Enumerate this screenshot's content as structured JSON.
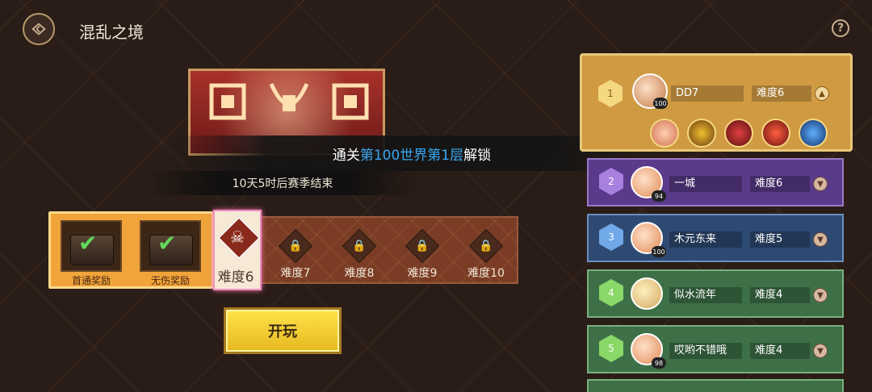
{
  "header": {
    "title": "混乱之境",
    "help_label": "?"
  },
  "unlock": {
    "prefix": "通关",
    "highlight": "第100世界第1层",
    "suffix": "解锁"
  },
  "season": {
    "text": "10天5时后赛季结束"
  },
  "rewards": [
    {
      "label": "首通奖励",
      "claimed": true
    },
    {
      "label": "无伤奖励",
      "claimed": true
    }
  ],
  "difficulty": {
    "current": "难度6",
    "locked": [
      "难度7",
      "难度8",
      "难度9",
      "难度10"
    ]
  },
  "play_button": {
    "label": "开玩"
  },
  "leaderboard": [
    {
      "rank": "1",
      "name": "DD7",
      "difficulty": "难度6",
      "level": "100",
      "expanded": true
    },
    {
      "rank": "2",
      "name": "一城",
      "difficulty": "难度6",
      "level": "94"
    },
    {
      "rank": "3",
      "name": "木元东来",
      "difficulty": "难度5",
      "level": "100"
    },
    {
      "rank": "4",
      "name": "似水流年",
      "difficulty": "难度4",
      "level": ""
    },
    {
      "rank": "5",
      "name": "哎哟不错哦",
      "difficulty": "难度4",
      "level": "98"
    }
  ],
  "colors": {
    "highlight": "#39a6f0",
    "rank_gold": "#cf9a42",
    "rank_purple": "#5a3a8a",
    "rank_blue": "#2e4a72",
    "rank_green": "#3e7048"
  },
  "icons": [
    "back-arrow-icon",
    "help-icon",
    "lock-icon",
    "check-icon",
    "chevron-up-icon",
    "chevron-down-icon",
    "skull-icon"
  ]
}
